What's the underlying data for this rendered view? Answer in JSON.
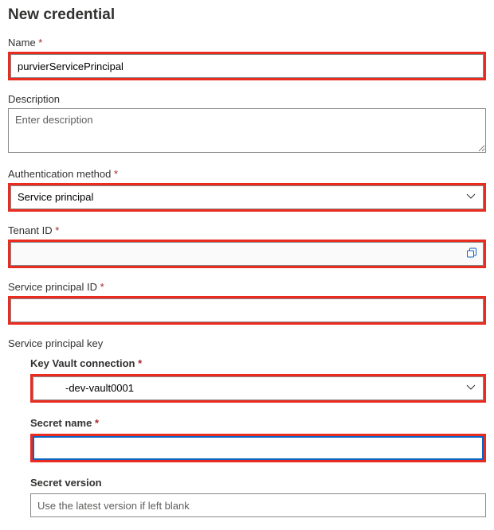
{
  "title": "New credential",
  "fields": {
    "name": {
      "label": "Name",
      "value": "purvierServicePrincipal"
    },
    "description": {
      "label": "Description",
      "placeholder": "Enter description"
    },
    "authMethod": {
      "label": "Authentication method",
      "value": "Service principal"
    },
    "tenantId": {
      "label": "Tenant ID",
      "value": ""
    },
    "spId": {
      "label": "Service principal ID",
      "value": ""
    },
    "spKey": {
      "label": "Service principal key"
    },
    "kvConn": {
      "label": "Key Vault connection",
      "value": "-dev-vault0001"
    },
    "secretName": {
      "label": "Secret name",
      "value": ""
    },
    "secretVersion": {
      "label": "Secret version",
      "placeholder": "Use the latest version if left blank"
    }
  }
}
